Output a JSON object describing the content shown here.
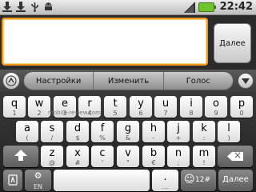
{
  "status_bar": {
    "time": "22:42",
    "icons": [
      "download-icon",
      "download-icon",
      "usb-icon",
      "android-icon",
      "signal-icon",
      "battery-icon"
    ]
  },
  "input": {
    "value": "",
    "next_label": "Далее"
  },
  "suggestion_strip": {
    "items": [
      "Настройки",
      "Изменить",
      "Голос"
    ]
  },
  "watermark": "mobile-review.com",
  "keyboard": {
    "row1": [
      {
        "main": "q",
        "alt": "1"
      },
      {
        "main": "w",
        "alt": "2"
      },
      {
        "main": "e",
        "alt": "3"
      },
      {
        "main": "r",
        "alt": "4"
      },
      {
        "main": "t",
        "alt": "5"
      },
      {
        "main": "y",
        "alt": "6"
      },
      {
        "main": "u",
        "alt": "7"
      },
      {
        "main": "i",
        "alt": "8"
      },
      {
        "main": "o",
        "alt": "9"
      },
      {
        "main": "p",
        "alt": "0"
      }
    ],
    "row2": [
      {
        "main": "a",
        "alt": "("
      },
      {
        "main": "s",
        "alt": "/"
      },
      {
        "main": "d",
        "alt": "$"
      },
      {
        "main": "f",
        "alt": "%"
      },
      {
        "main": "g",
        "alt": "&"
      },
      {
        "main": "h",
        "alt": "-"
      },
      {
        "main": "j",
        "alt": "+"
      },
      {
        "main": "k",
        "alt": ":"
      },
      {
        "main": "l",
        "alt": ")"
      }
    ],
    "row3": [
      {
        "main": "z",
        "alt": "@"
      },
      {
        "main": "x",
        "alt": "#"
      },
      {
        "main": "c",
        "alt": "'"
      },
      {
        "main": "v",
        "alt": "\""
      },
      {
        "main": "b",
        "alt": "€"
      },
      {
        "main": "n",
        "alt": ";"
      },
      {
        "main": "m",
        "alt": "!"
      }
    ],
    "bottom": {
      "lang_label": "EN",
      "sym_label": "12#",
      "smiley": "☺",
      "enter_label": "Далее",
      "period": ".",
      "period_alt": ",",
      "ellipsis": "..."
    }
  }
}
